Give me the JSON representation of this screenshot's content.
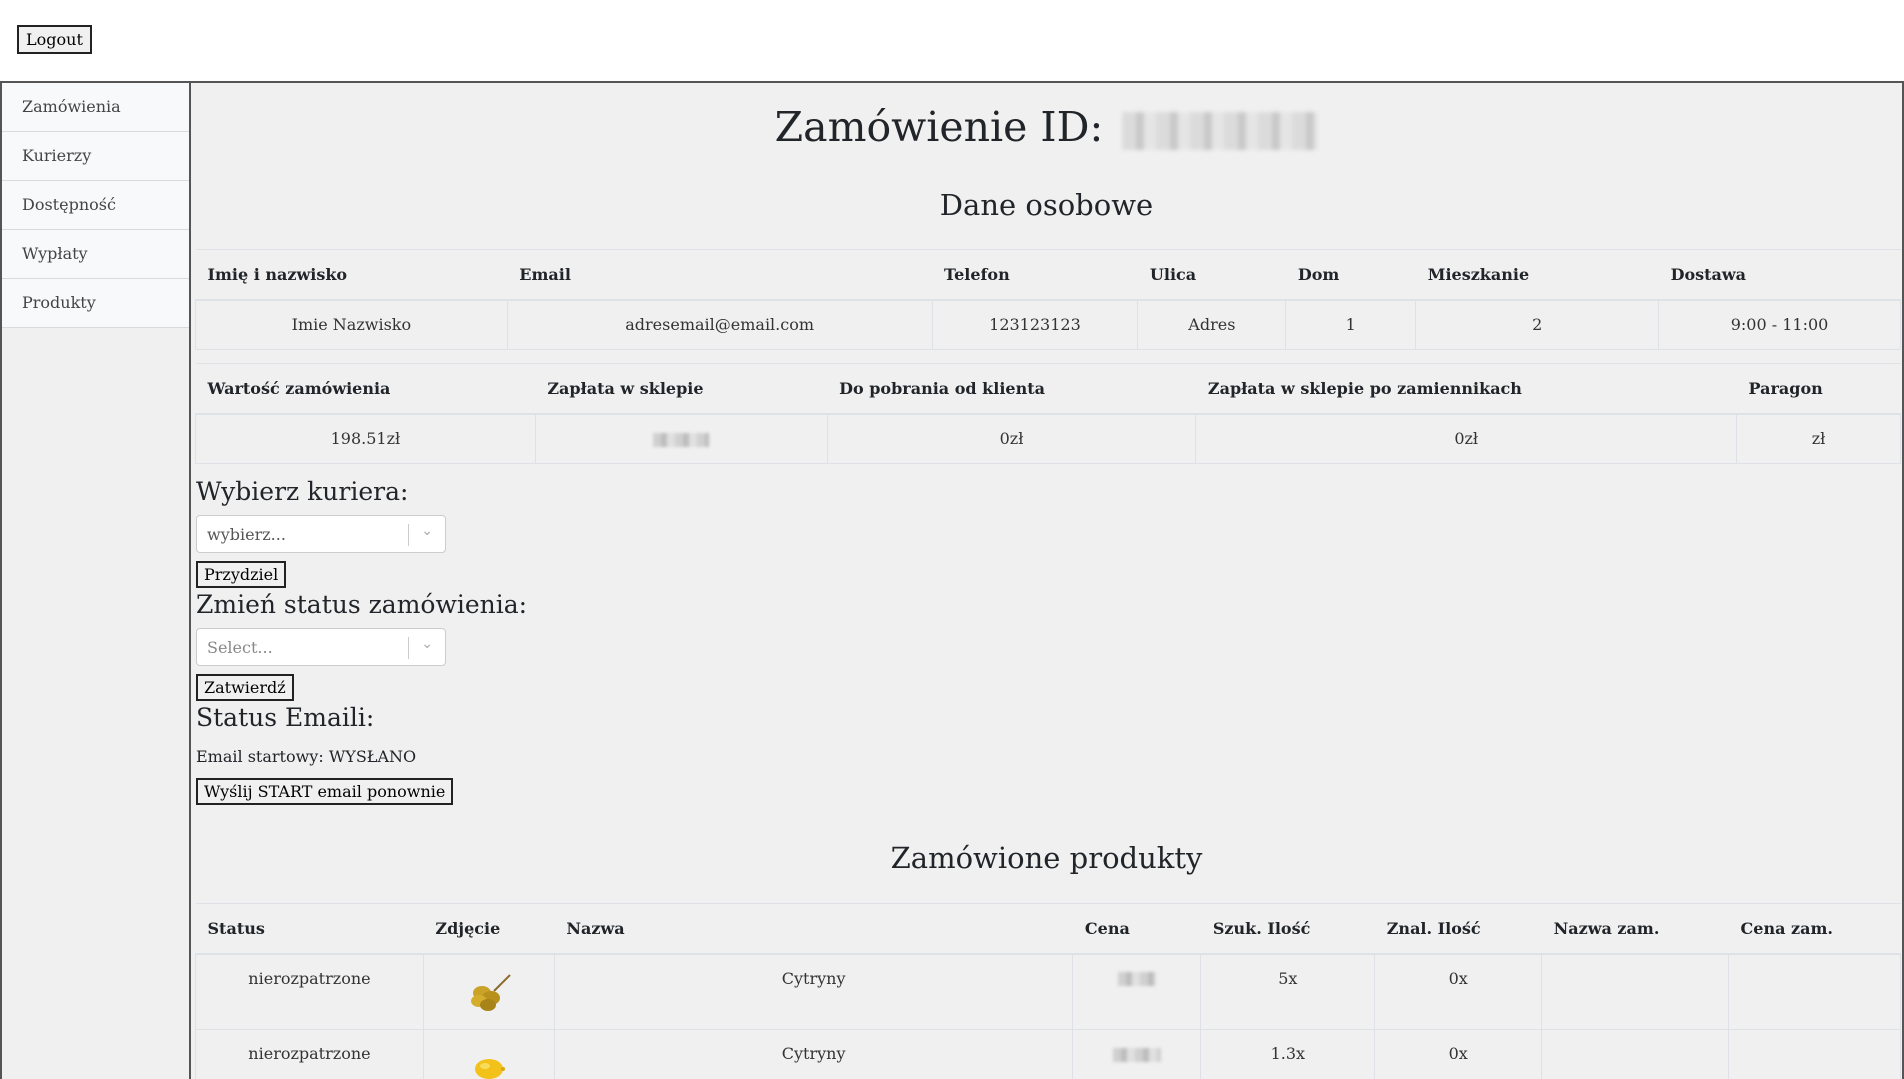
{
  "header": {
    "logout_label": "Logout"
  },
  "sidebar": {
    "items": [
      {
        "label": "Zamówienia"
      },
      {
        "label": "Kurierzy"
      },
      {
        "label": "Dostępność"
      },
      {
        "label": "Wypłaty"
      },
      {
        "label": "Produkty"
      }
    ]
  },
  "order": {
    "title_prefix": "Zamówienie ID:",
    "personal_section_title": "Dane osobowe",
    "personal_headers": [
      "Imię i nazwisko",
      "Email",
      "Telefon",
      "Ulica",
      "Dom",
      "Mieszkanie",
      "Dostawa"
    ],
    "personal_row": [
      "Imie Nazwisko",
      "adresemail@email.com",
      "123123123",
      "Adres",
      "1",
      "2",
      "9:00 - 11:00"
    ],
    "payment_headers": [
      "Wartość zamówienia",
      "Zapłata w sklepie",
      "Do pobrania od klienta",
      "Zapłata w sklepie po zamiennikach",
      "Paragon"
    ],
    "payment_row": [
      "198.51zł",
      "",
      "0zł",
      "0zł",
      "zł"
    ]
  },
  "courier": {
    "label": "Wybierz kuriera:",
    "select_value": "wybierz...",
    "assign_label": "Przydziel"
  },
  "status": {
    "label": "Zmień status zamówienia:",
    "select_placeholder": "Select...",
    "confirm_label": "Zatwierdź"
  },
  "emails": {
    "label": "Status Emaili:",
    "start_status": "Email startowy: WYSŁANO",
    "resend_label": "Wyślij START email ponownie"
  },
  "products": {
    "section_title": "Zamówione produkty",
    "headers": [
      "Status",
      "Zdjęcie",
      "Nazwa",
      "Cena",
      "Szuk. Ilość",
      "Znal. Ilość",
      "Nazwa zam.",
      "Cena zam."
    ],
    "rows": [
      {
        "status": "nierozpatrzone",
        "image": "lemons-bunch-image",
        "name": "Cytryny",
        "price": "",
        "requested_qty": "5x",
        "found_qty": "0x",
        "sub_name": "",
        "sub_price": ""
      },
      {
        "status": "nierozpatrzone",
        "image": "lemon-image",
        "name": "Cytryny",
        "price": "",
        "requested_qty": "1.3x",
        "found_qty": "0x",
        "sub_name": "",
        "sub_price": ""
      }
    ]
  },
  "icons": {
    "select_arrow": "chevron-down-icon"
  }
}
